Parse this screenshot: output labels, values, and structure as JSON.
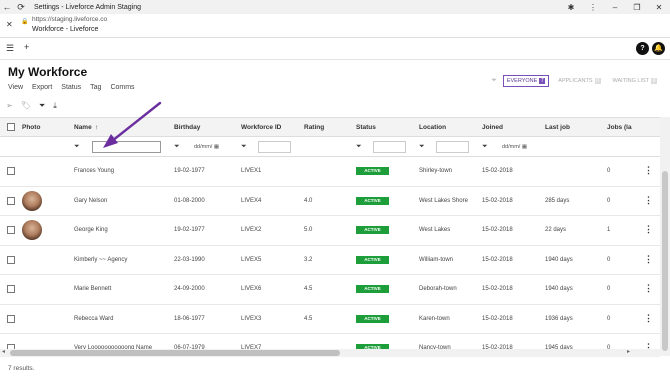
{
  "browser": {
    "window_title": "Settings - Liveforce Admin Staging",
    "url": "https://staging.liveforce.co",
    "page_title": "Workforce - Liveforce"
  },
  "app": {
    "help_label": "?",
    "page_title": "My Workforce",
    "menu": [
      "View",
      "Export",
      "Status",
      "Tag",
      "Comms"
    ]
  },
  "tabs": [
    {
      "label": "EVERYONE",
      "count": "7"
    },
    {
      "label": "APPLICANTS",
      "count": "0"
    },
    {
      "label": "WAITING LIST",
      "count": "0"
    }
  ],
  "columns": {
    "photo": "Photo",
    "name": "Name",
    "sort_icon": "↑",
    "birthday": "Birthday",
    "workforce_id": "Workforce ID",
    "rating": "Rating",
    "status": "Status",
    "location": "Location",
    "joined": "Joined",
    "last_job": "Last job",
    "jobs": "Jobs (la"
  },
  "filters": {
    "date_placeholder": "dd/mm/"
  },
  "rows": [
    {
      "name": "Frances Young",
      "birthday": "19-02-1977",
      "id": "LIVEX1",
      "rating": "",
      "status": "ACTIVE",
      "location": "Shirley-town",
      "joined": "15-02-2018",
      "last_job": "",
      "jobs": "0",
      "avatar": false
    },
    {
      "name": "Gary Nelson",
      "birthday": "01-08-2000",
      "id": "LIVEX4",
      "rating": "4.0",
      "status": "ACTIVE",
      "location": "West Lakes Shore",
      "joined": "15-02-2018",
      "last_job": "285 days",
      "jobs": "0",
      "avatar": true
    },
    {
      "name": "George King",
      "birthday": "19-02-1977",
      "id": "LIVEX2",
      "rating": "5.0",
      "status": "ACTIVE",
      "location": "West Lakes",
      "joined": "15-02-2018",
      "last_job": "22 days",
      "jobs": "1",
      "avatar": true
    },
    {
      "name": "Kimberly ~~ Agency",
      "birthday": "22-03-1990",
      "id": "LIVEX5",
      "rating": "3.2",
      "status": "ACTIVE",
      "location": "William-town",
      "joined": "15-02-2018",
      "last_job": "1940 days",
      "jobs": "0",
      "avatar": false
    },
    {
      "name": "Marie Bennett",
      "birthday": "24-09-2000",
      "id": "LIVEX6",
      "rating": "4.5",
      "status": "ACTIVE",
      "location": "Deborah-town",
      "joined": "15-02-2018",
      "last_job": "1940 days",
      "jobs": "0",
      "avatar": false
    },
    {
      "name": "Rebecca Ward",
      "birthday": "18-06-1977",
      "id": "LIVEX3",
      "rating": "4.5",
      "status": "ACTIVE",
      "location": "Karen-town",
      "joined": "15-02-2018",
      "last_job": "1936 days",
      "jobs": "0",
      "avatar": false
    },
    {
      "name": "Very Looooooooooong Name",
      "birthday": "06-07-1979",
      "id": "LIVEX7",
      "rating": "",
      "status": "ACTIVE",
      "location": "Nancy-town",
      "joined": "15-02-2018",
      "last_job": "1945 days",
      "jobs": "0",
      "avatar": false
    }
  ],
  "footer": {
    "results": "7 results."
  },
  "colors": {
    "accent": "#7a4fb8",
    "active": "#1e9e3a"
  }
}
